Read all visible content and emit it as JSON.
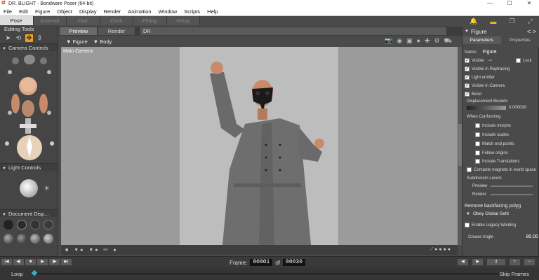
{
  "window": {
    "title": "DR. BLIGHT - Bondware Poser (64-bit)",
    "logo": "Ø"
  },
  "menubar": [
    "File",
    "Edit",
    "Figure",
    "Object",
    "Display",
    "Render",
    "Animation",
    "Window",
    "Scripts",
    "Help"
  ],
  "rooms": [
    "Pose",
    "Material",
    "Hair",
    "Cloth",
    "Fitting",
    "Setup"
  ],
  "active_room": "Pose",
  "left_panel": {
    "editing_tools": "Editing Tools",
    "camera_controls": "Camera Controls",
    "light_controls": "Light Controls",
    "document_display": "Document Disp..."
  },
  "view_tabs": [
    "Preview",
    "Render"
  ],
  "view_name": "DR",
  "view_toolbar": {
    "figure_dropdown": "Figure",
    "body_dropdown": "Body"
  },
  "viewport": {
    "camera_label": "Main Camera"
  },
  "animation": {
    "frame_label": "Frame:",
    "current_frame": "00001",
    "of_label": "of",
    "total_frames": "00030",
    "loop_label": "Loop",
    "skip_frames_label": "Skip Frames"
  },
  "right_panel": {
    "header": "Figure",
    "tabs": [
      "Parameters",
      "Properties"
    ],
    "name_label": "Name:",
    "name_value": "Figure",
    "visible": "Visible",
    "lock": "Lock",
    "visible_in_raytracing": "Visible in Raytracing",
    "light_emitter": "Light emitter",
    "visible_in_camera": "Visible in Camera",
    "bend": "Bend",
    "displacement_bounds": "Displacement Bounds",
    "displacement_value": "0.000000",
    "when_conforming": "When Conforming",
    "include_morphs": "Include morphs",
    "include_scales": "Include scales",
    "match_end_points": "Match end points",
    "follow_origins": "Follow origins",
    "include_translations": "Include Translations",
    "compute_magnets": "Compute magnets in world space",
    "subdivision_levels": "Subdivision Levels",
    "preview_label": "Preview",
    "render_label": "Render",
    "remove_backfacing": "Remove backfacing polyg",
    "obey_global": "Obey Global Setti",
    "legacy_welding": "Enable Legacy Welding",
    "crease_angle_label": "Crease Angle",
    "crease_angle_value": "80.00"
  },
  "colors": {
    "accent": "#e8a020",
    "figure_coat": "#6e6e6e",
    "skin": "#c98a6a",
    "mask": "#1a1a1a"
  }
}
